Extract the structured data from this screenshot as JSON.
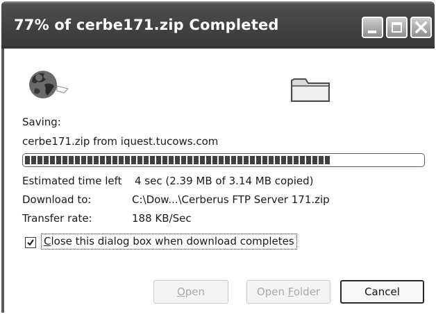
{
  "window": {
    "title": "77% of cerbe171.zip Completed"
  },
  "caption_buttons": {
    "minimize": "minimize-icon",
    "maximize": "maximize-icon",
    "close": "close-icon"
  },
  "animation": {
    "source_icon": "globe-icon",
    "destination_icon": "folder-icon"
  },
  "status": {
    "saving_label": "Saving:",
    "file_source": "cerbe171.zip from iquest.tucows.com"
  },
  "progress": {
    "percent": 77
  },
  "details": {
    "estimated_label": "Estimated time left",
    "estimated_value": "4 sec (2.39 MB of 3.14 MB copied)",
    "download_to_label": "Download to:",
    "download_to_value": "C:\\Dow...\\Cerberus FTP Server 171.zip",
    "transfer_rate_label": "Transfer rate:",
    "transfer_rate_value": "188 KB/Sec"
  },
  "close_on_complete": {
    "checked": true,
    "label_first": "C",
    "label_rest": "lose this dialog box when download completes"
  },
  "buttons": {
    "open_mnemonic": "O",
    "open_rest": "pen",
    "open_folder_prefix": "Open ",
    "open_folder_mnemonic": "F",
    "open_folder_rest": "older",
    "cancel": "Cancel"
  }
}
